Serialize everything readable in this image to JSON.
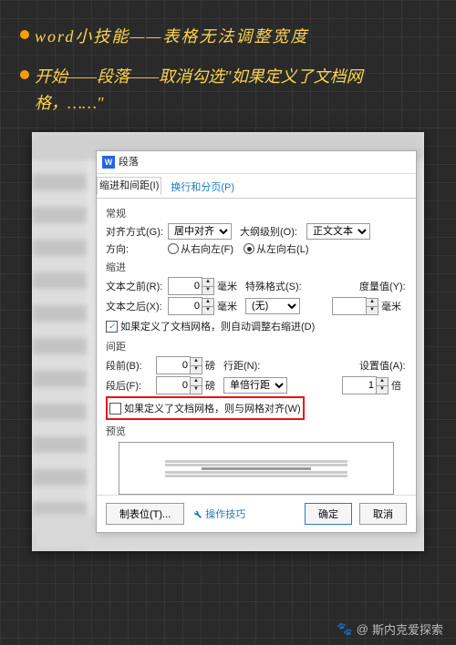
{
  "note": {
    "title": "word小技能——表格无法调整宽度",
    "body": "开始——段落——取消勾选\"如果定义了文档网格，……\""
  },
  "dialog": {
    "title": "段落",
    "tabs": [
      "缩进和间距(I)",
      "换行和分页(P)"
    ],
    "sections": {
      "general": "常规",
      "indent": "缩进",
      "spacing": "间距",
      "preview": "预览"
    },
    "general": {
      "align_label": "对齐方式(G):",
      "align_value": "居中对齐",
      "outline_label": "大纲级别(O):",
      "outline_value": "正文文本",
      "direction_label": "方向:",
      "rtl": "从右向左(F)",
      "ltr": "从左向右(L)"
    },
    "indent": {
      "before_label": "文本之前(R):",
      "before_value": "0",
      "unit_mm": "毫米",
      "special_label": "特殊格式(S):",
      "special_value": "(无)",
      "measure_label": "度量值(Y):",
      "measure_value": "",
      "after_label": "文本之后(X):",
      "after_value": "0",
      "auto_adjust": "如果定义了文档网格，则自动调整右缩进(D)"
    },
    "spacing": {
      "before_label": "段前(B):",
      "before_value": "0",
      "unit_pt": "磅",
      "line_label": "行距(N):",
      "line_value": "单倍行距",
      "at_label": "设置值(A):",
      "at_value": "1",
      "unit_x": "倍",
      "after_label": "段后(F):",
      "after_value": "0",
      "snap_grid": "如果定义了文档网格，则与网格对齐(W)"
    },
    "buttons": {
      "tabs": "制表位(T)...",
      "tips": "操作技巧",
      "ok": "确定",
      "cancel": "取消"
    }
  },
  "watermark": "斯内克爱探索"
}
